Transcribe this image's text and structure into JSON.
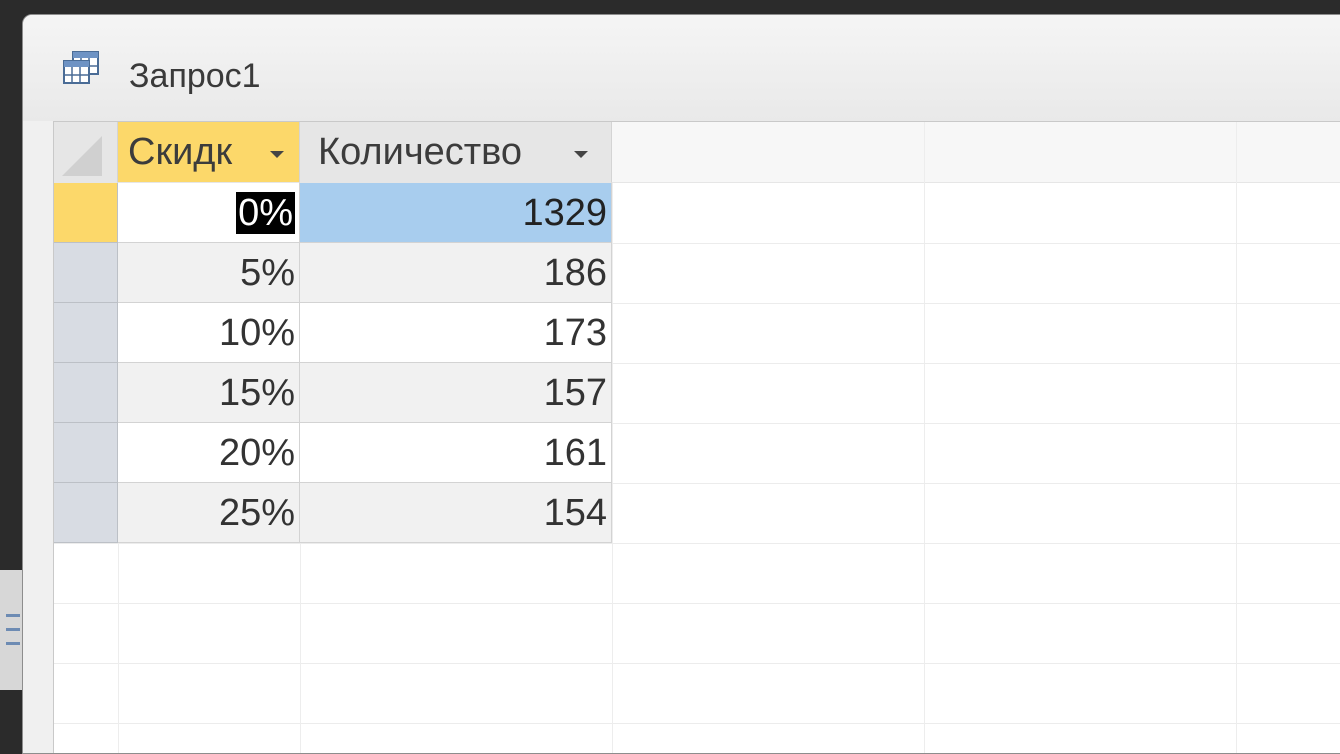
{
  "window": {
    "title": "Запрос1",
    "icon": "datasheet-table-icon"
  },
  "columns": [
    {
      "label": "Скидк",
      "dropdown_icon": "chevron-down-icon"
    },
    {
      "label": "Количество",
      "dropdown_icon": "chevron-down-icon"
    }
  ],
  "rows": [
    {
      "discount": "0%",
      "count": "1329"
    },
    {
      "discount": "5%",
      "count": "186"
    },
    {
      "discount": "10%",
      "count": "173"
    },
    {
      "discount": "15%",
      "count": "157"
    },
    {
      "discount": "20%",
      "count": "161"
    },
    {
      "discount": "25%",
      "count": "154"
    }
  ],
  "colors": {
    "selected_header": "#fcd86a",
    "selected_row_selector": "#fcd86a",
    "selected_cell": "#a8cdee"
  }
}
